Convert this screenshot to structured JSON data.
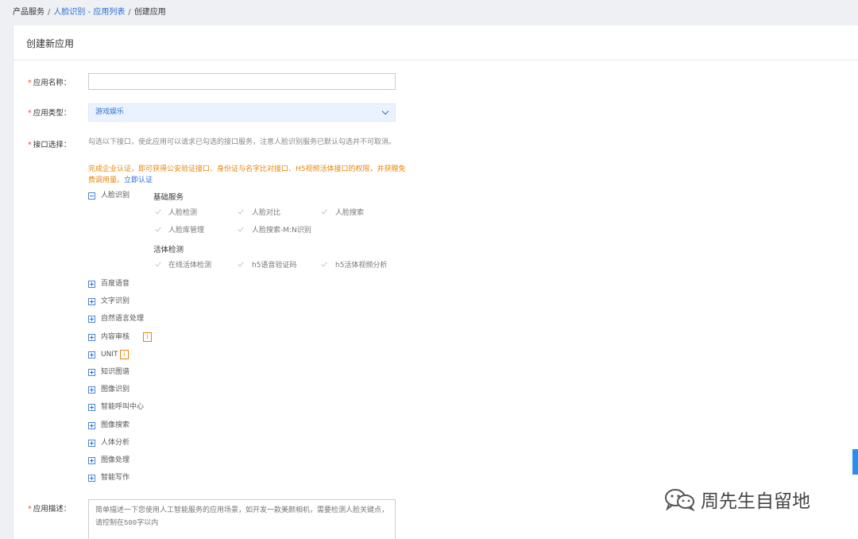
{
  "breadcrumb": {
    "root": "产品服务",
    "sep": "/",
    "middle": "人脸识别 - 应用列表",
    "current": "创建应用"
  },
  "card": {
    "title": "创建新应用"
  },
  "form": {
    "name_label": "应用名称：",
    "type_label": "应用类型：",
    "type_value": "游戏娱乐",
    "api_label": "接口选择：",
    "desc_label": "应用描述：",
    "required_mark": "*",
    "name_value": ""
  },
  "hint": {
    "text": "勾选以下接口，使此应用可以请求已勾选的接口服务，注意人脸识别服务已默认勾选并不可取消。",
    "warn": "完成企业认证，即可获得公安验证接口、身份证与名字比对接口、H5视频活体接口的权限，并获赠免费调用量。",
    "auth_link": "立即认证"
  },
  "tree": {
    "face": {
      "label": "人脸识别",
      "groups": [
        {
          "title": "基础服务",
          "items": [
            "人脸检测",
            "人脸对比",
            "人脸搜索",
            "人脸库管理",
            "人脸搜索-M:N识别"
          ]
        },
        {
          "title": "活体检测",
          "items": [
            "在线活体检测",
            "h5语音验证码",
            "h5活体视频分析"
          ]
        }
      ]
    },
    "others": [
      "百度语音",
      "文字识别",
      "自然语言处理",
      "内容审核",
      "UNIT",
      "知识图谱",
      "图像识别",
      "智能呼叫中心",
      "图像搜索",
      "人体分析",
      "图像处理",
      "智能写作"
    ],
    "badge_text": "i"
  },
  "desc": {
    "placeholder": "简单描述一下您使用人工智能服务的应用场景，如开发一款美颜相机，需要检测人脸关键点，请控制在500字以内"
  },
  "watermark": {
    "text": "周先生自留地"
  },
  "colors": {
    "accent": "#2b6fd6",
    "warning": "#e8860a",
    "required": "#e84c3d"
  }
}
